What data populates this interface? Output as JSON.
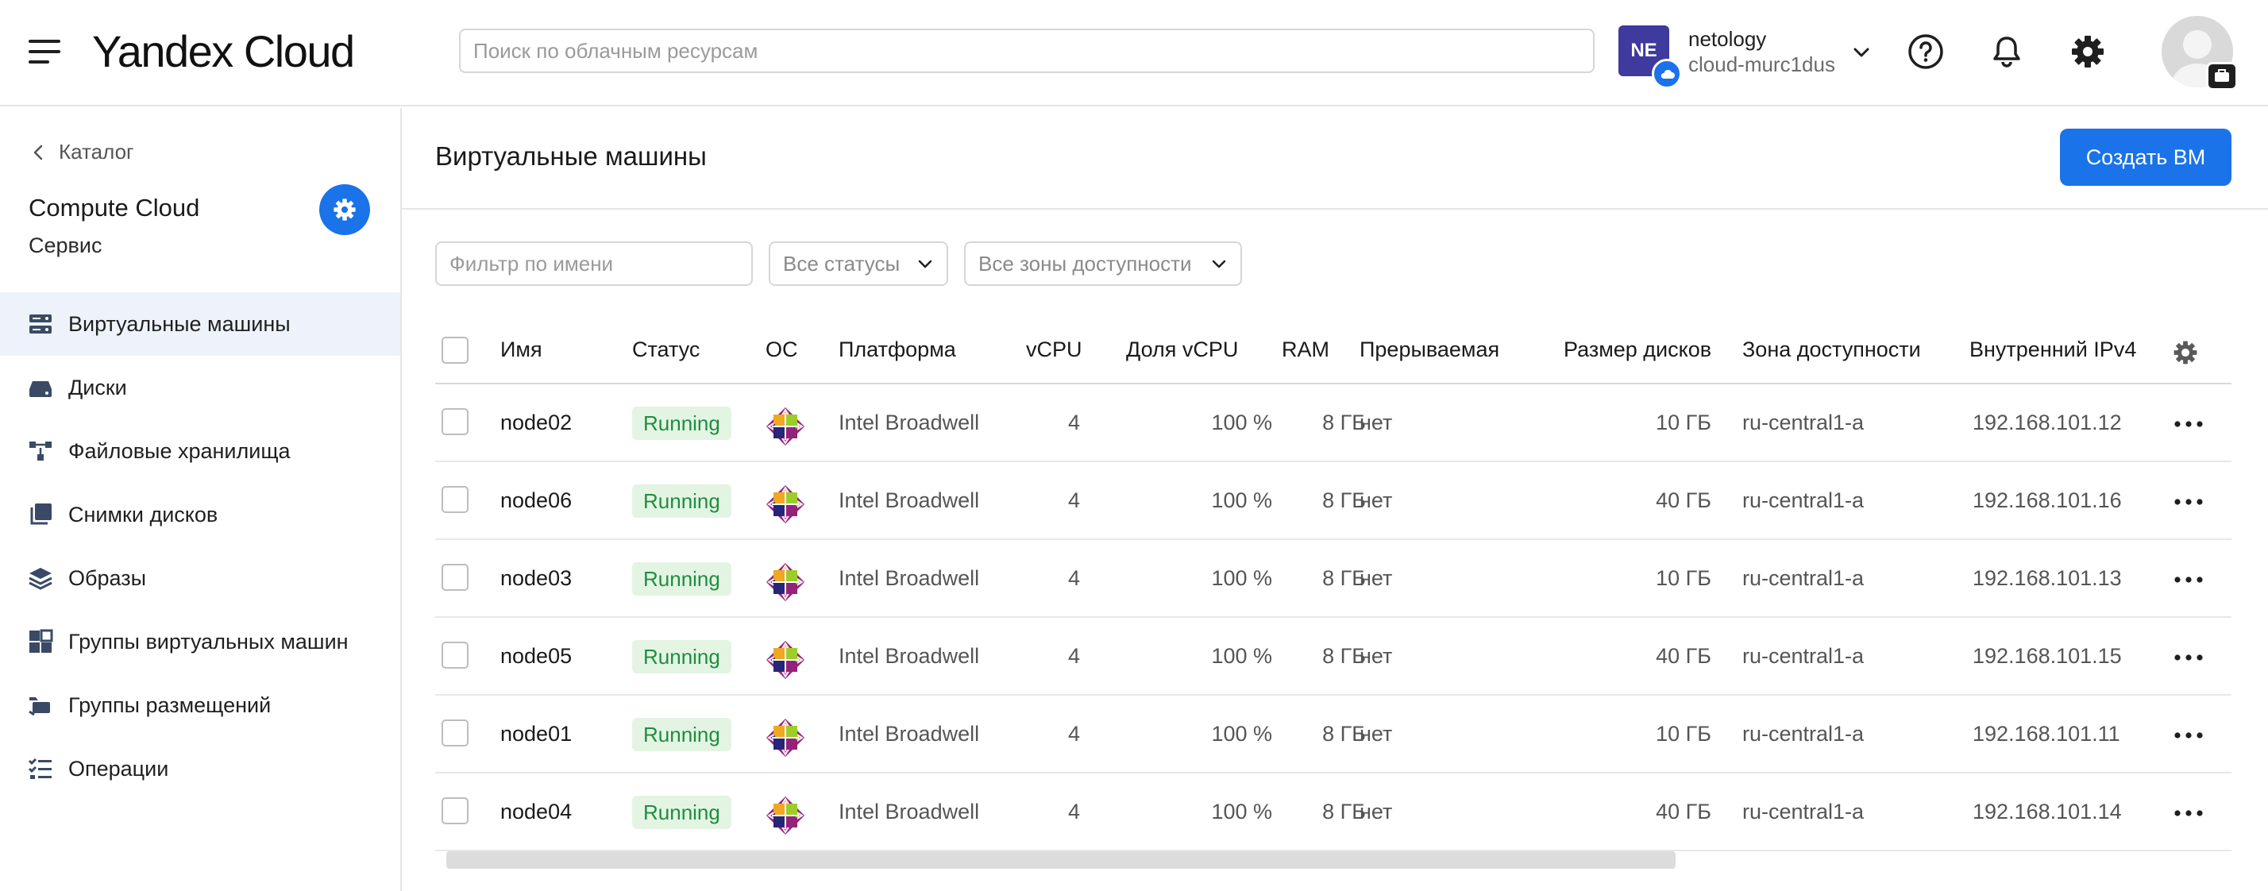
{
  "header": {
    "logo": "Yandex Cloud",
    "search_placeholder": "Поиск по облачным ресурсам",
    "cloud_initials": "NE",
    "account_name": "netology",
    "cloud_name": "cloud-murc1dus"
  },
  "sidebar": {
    "back_label": "Каталог",
    "service_title": "Compute Cloud",
    "service_subtitle": "Сервис",
    "items": [
      {
        "label": "Виртуальные машины",
        "icon": "server-icon",
        "active": true
      },
      {
        "label": "Диски",
        "icon": "disk-icon"
      },
      {
        "label": "Файловые хранилища",
        "icon": "file-storage-icon"
      },
      {
        "label": "Снимки дисков",
        "icon": "snapshot-icon"
      },
      {
        "label": "Образы",
        "icon": "layers-icon"
      },
      {
        "label": "Группы виртуальных машин",
        "icon": "vm-group-icon"
      },
      {
        "label": "Группы размещений",
        "icon": "placement-group-icon"
      },
      {
        "label": "Операции",
        "icon": "operations-list-icon"
      }
    ]
  },
  "main": {
    "title": "Виртуальные машины",
    "create_button": "Создать ВМ",
    "filter_placeholder": "Фильтр по имени",
    "status_select": "Все статусы",
    "zone_select": "Все зоны доступности"
  },
  "table": {
    "columns": [
      "Имя",
      "Статус",
      "ОС",
      "Платформа",
      "vCPU",
      "Доля vCPU",
      "RAM",
      "Прерываемая",
      "Размер дисков",
      "Зона доступности",
      "Внутренний IPv4"
    ],
    "rows": [
      {
        "name": "node02",
        "status": "Running",
        "os": "centos-icon",
        "platform": "Intel Broadwell",
        "vcpu": "4",
        "vcpu_share": "100 %",
        "ram": "8 ГБ",
        "preemptible": "нет",
        "disk_size": "10 ГБ",
        "zone": "ru-central1-a",
        "ipv4": "192.168.101.12"
      },
      {
        "name": "node06",
        "status": "Running",
        "os": "centos-icon",
        "platform": "Intel Broadwell",
        "vcpu": "4",
        "vcpu_share": "100 %",
        "ram": "8 ГБ",
        "preemptible": "нет",
        "disk_size": "40 ГБ",
        "zone": "ru-central1-a",
        "ipv4": "192.168.101.16"
      },
      {
        "name": "node03",
        "status": "Running",
        "os": "centos-icon",
        "platform": "Intel Broadwell",
        "vcpu": "4",
        "vcpu_share": "100 %",
        "ram": "8 ГБ",
        "preemptible": "нет",
        "disk_size": "10 ГБ",
        "zone": "ru-central1-a",
        "ipv4": "192.168.101.13"
      },
      {
        "name": "node05",
        "status": "Running",
        "os": "centos-icon",
        "platform": "Intel Broadwell",
        "vcpu": "4",
        "vcpu_share": "100 %",
        "ram": "8 ГБ",
        "preemptible": "нет",
        "disk_size": "40 ГБ",
        "zone": "ru-central1-a",
        "ipv4": "192.168.101.15"
      },
      {
        "name": "node01",
        "status": "Running",
        "os": "centos-icon",
        "platform": "Intel Broadwell",
        "vcpu": "4",
        "vcpu_share": "100 %",
        "ram": "8 ГБ",
        "preemptible": "нет",
        "disk_size": "10 ГБ",
        "zone": "ru-central1-a",
        "ipv4": "192.168.101.11"
      },
      {
        "name": "node04",
        "status": "Running",
        "os": "centos-icon",
        "platform": "Intel Broadwell",
        "vcpu": "4",
        "vcpu_share": "100 %",
        "ram": "8 ГБ",
        "preemptible": "нет",
        "disk_size": "40 ГБ",
        "zone": "ru-central1-a",
        "ipv4": "192.168.101.14"
      }
    ]
  },
  "colors": {
    "accent": "#1a73e8",
    "running_text": "#1e8e3e",
    "running_bg": "#e3f4e3",
    "active_nav_bg": "#eef3fb",
    "cloud_avatar": "#3e3a9e"
  }
}
